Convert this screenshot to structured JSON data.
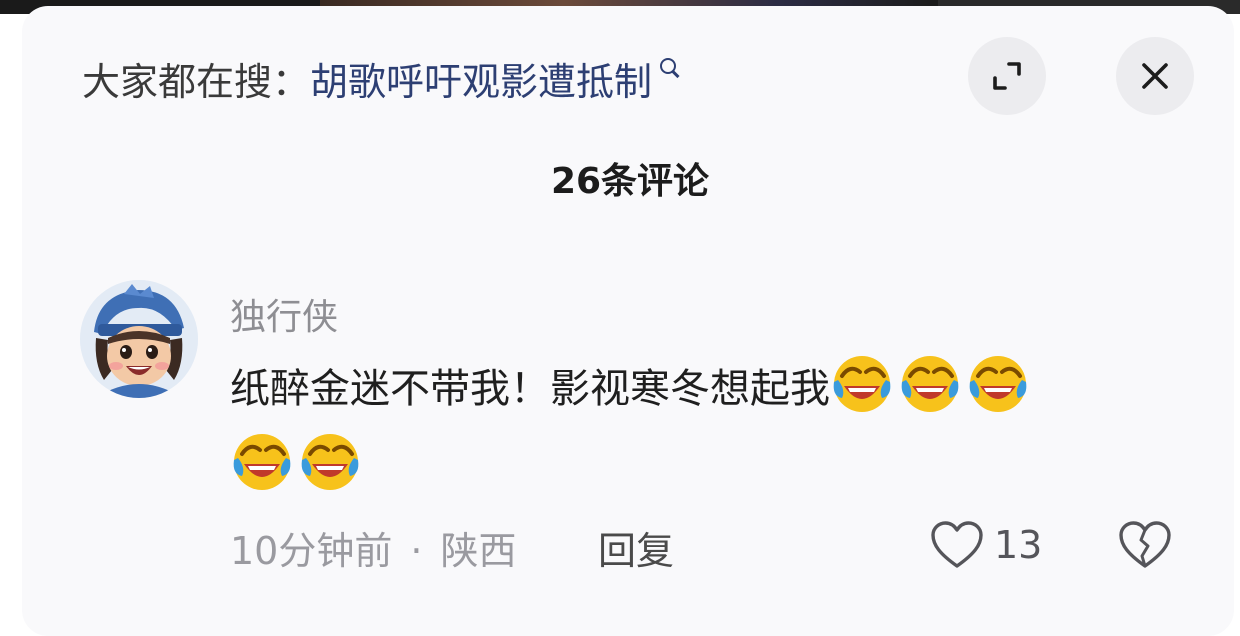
{
  "search_bar": {
    "prefix": "大家都在搜：",
    "query": "胡歌呼吁观影遭抵制",
    "icon": "search-icon"
  },
  "header_actions": {
    "expand_icon": "expand-icon",
    "close_icon": "close-icon"
  },
  "comments_header": {
    "count_label": "26条评论"
  },
  "comment": {
    "username": "独行侠",
    "avatar": "avatar",
    "text": "纸醉金迷不带我！影视寒冬想起我",
    "emojis": [
      "laugh-cry-emoji",
      "laugh-cry-emoji",
      "laugh-cry-emoji",
      "laugh-cry-emoji",
      "laugh-cry-emoji"
    ],
    "time": "10分钟前",
    "separator": "·",
    "location": "陕西",
    "reply_label": "回复",
    "like_count": "13",
    "like_icon": "heart-icon",
    "dislike_icon": "broken-heart-icon"
  },
  "colors": {
    "query_link": "#2d3f73",
    "muted_text": "#8e8e93",
    "panel_bg": "#f9f9fb",
    "button_bg": "#ececef"
  }
}
